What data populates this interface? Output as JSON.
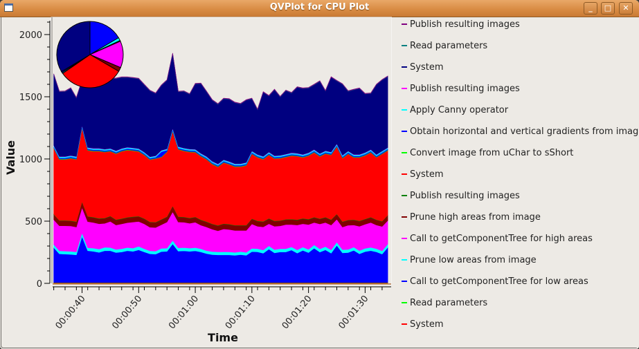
{
  "window": {
    "title": "QVPlot for CPU Plot",
    "buttons": {
      "minimize": "_",
      "maximize": "□",
      "close": "✕"
    }
  },
  "chart_data": {
    "type": "area",
    "stacked": true,
    "xlabel": "Time",
    "ylabel": "Value",
    "ylim": [
      0,
      2140
    ],
    "xlim_seconds": [
      34.8,
      94.6
    ],
    "yticks": [
      0,
      500,
      1000,
      1500,
      2000
    ],
    "xticks": [
      {
        "t": 40,
        "label": "00:00:40"
      },
      {
        "t": 50,
        "label": "00:00:50"
      },
      {
        "t": 60,
        "label": "00:01:00"
      },
      {
        "t": 70,
        "label": "00:01:10"
      },
      {
        "t": 80,
        "label": "00:01:20"
      },
      {
        "t": 90,
        "label": "00:01:30"
      }
    ],
    "legend_position": "right",
    "x": [
      35,
      36,
      37,
      38,
      39,
      40,
      41,
      42,
      43,
      44,
      45,
      46,
      47,
      48,
      49,
      50,
      51,
      52,
      53,
      54,
      55,
      56,
      57,
      58,
      59,
      60,
      61,
      62,
      63,
      64,
      65,
      66,
      67,
      68,
      69,
      70,
      71,
      72,
      73,
      74,
      75,
      76,
      77,
      78,
      79,
      80,
      81,
      82,
      83,
      84,
      85,
      86,
      87,
      88,
      89,
      90,
      91,
      92,
      93,
      94
    ],
    "series_stack_order_bottom_to_top": [
      {
        "name": "System",
        "color": "#e00000",
        "values": [
          5,
          5,
          5,
          5,
          5,
          5,
          5,
          5,
          5,
          5,
          5,
          5,
          5,
          5,
          5,
          5,
          5,
          5,
          5,
          5,
          5,
          5,
          5,
          5,
          5,
          5,
          5,
          5,
          5,
          5,
          5,
          5,
          5,
          5,
          5,
          5,
          5,
          5,
          5,
          5,
          5,
          5,
          5,
          5,
          5,
          5,
          5,
          5,
          5,
          5,
          5,
          5,
          5,
          5,
          5,
          5,
          5,
          5,
          5,
          5
        ]
      },
      {
        "name": "Read parameters",
        "color": "#00cc00",
        "values": [
          2,
          2,
          2,
          2,
          2,
          2,
          2,
          2,
          2,
          2,
          2,
          2,
          2,
          2,
          2,
          2,
          2,
          2,
          2,
          2,
          2,
          2,
          2,
          2,
          2,
          2,
          2,
          2,
          2,
          2,
          2,
          2,
          2,
          2,
          2,
          2,
          2,
          2,
          2,
          2,
          2,
          2,
          2,
          2,
          2,
          2,
          2,
          2,
          2,
          2,
          2,
          2,
          2,
          2,
          2,
          2,
          2,
          2,
          2,
          2
        ]
      },
      {
        "name": "Call to getComponentTree for low areas",
        "color": "#0000ff",
        "values": [
          280,
          230,
          228,
          226,
          222,
          370,
          255,
          250,
          242,
          255,
          255,
          240,
          245,
          255,
          250,
          262,
          245,
          230,
          228,
          248,
          250,
          310,
          252,
          254,
          250,
          254,
          245,
          232,
          224,
          222,
          222,
          222,
          218,
          224,
          218,
          248,
          246,
          235,
          268,
          238,
          245,
          245,
          260,
          236,
          258,
          240,
          276,
          244,
          262,
          236,
          298,
          238,
          240,
          258,
          230,
          248,
          256,
          246,
          228,
          282
        ]
      },
      {
        "name": "Prune low areas from image",
        "color": "#00ffff",
        "values": [
          26,
          24,
          24,
          24,
          24,
          28,
          24,
          26,
          26,
          28,
          26,
          26,
          26,
          26,
          26,
          28,
          26,
          24,
          24,
          26,
          26,
          28,
          26,
          26,
          26,
          26,
          26,
          24,
          24,
          24,
          24,
          24,
          24,
          24,
          24,
          26,
          26,
          26,
          26,
          26,
          26,
          26,
          26,
          26,
          26,
          26,
          26,
          26,
          26,
          26,
          26,
          26,
          26,
          26,
          26,
          26,
          26,
          26,
          26,
          26
        ]
      },
      {
        "name": "Call to getComponentTree for high areas",
        "color": "#ff00ff",
        "values": [
          200,
          202,
          204,
          204,
          200,
          204,
          210,
          206,
          204,
          192,
          210,
          196,
          200,
          200,
          210,
          200,
          200,
          190,
          190,
          190,
          210,
          230,
          208,
          204,
          200,
          204,
          190,
          190,
          180,
          170,
          184,
          180,
          176,
          170,
          176,
          196,
          180,
          186,
          178,
          188,
          184,
          194,
          180,
          200,
          188,
          200,
          180,
          200,
          194,
          200,
          184,
          182,
          194,
          178,
          196,
          194,
          200,
          190,
          196,
          190
        ]
      },
      {
        "name": "Prune high areas from image",
        "color": "#800000",
        "values": [
          40,
          40,
          40,
          40,
          40,
          44,
          40,
          40,
          40,
          40,
          40,
          40,
          40,
          40,
          40,
          40,
          40,
          40,
          40,
          40,
          40,
          44,
          40,
          40,
          40,
          40,
          40,
          40,
          40,
          40,
          40,
          40,
          40,
          40,
          40,
          40,
          40,
          40,
          40,
          40,
          40,
          40,
          40,
          40,
          40,
          40,
          40,
          40,
          40,
          40,
          40,
          40,
          40,
          40,
          40,
          40,
          40,
          40,
          40,
          40
        ]
      },
      {
        "name": "Publish resulting images",
        "color": "#008000",
        "values": [
          3,
          3,
          3,
          3,
          3,
          3,
          3,
          3,
          3,
          3,
          3,
          3,
          3,
          3,
          3,
          3,
          3,
          3,
          3,
          3,
          3,
          3,
          3,
          3,
          3,
          3,
          3,
          3,
          3,
          3,
          3,
          3,
          3,
          3,
          3,
          3,
          3,
          3,
          3,
          3,
          3,
          3,
          3,
          3,
          3,
          3,
          3,
          3,
          3,
          3,
          3,
          3,
          3,
          3,
          3,
          3,
          3,
          3,
          3,
          3
        ]
      },
      {
        "name": "System",
        "color": "#ff0000",
        "values": [
          530,
          490,
          490,
          500,
          500,
          590,
          530,
          530,
          540,
          530,
          520,
          530,
          540,
          540,
          530,
          520,
          510,
          500,
          510,
          500,
          520,
          600,
          540,
          530,
          530,
          520,
          510,
          500,
          480,
          470,
          490,
          480,
          470,
          470,
          480,
          520,
          510,
          500,
          510,
          500,
          500,
          500,
          510,
          510,
          490,
          510,
          520,
          500,
          510,
          520,
          540,
          510,
          530,
          500,
          510,
          510,
          520,
          500,
          540,
          520
        ]
      },
      {
        "name": "Convert image from uChar to sShort",
        "color": "#00ff00",
        "values": [
          4,
          4,
          4,
          4,
          4,
          4,
          4,
          4,
          4,
          4,
          4,
          4,
          4,
          4,
          4,
          4,
          4,
          4,
          4,
          4,
          4,
          4,
          4,
          4,
          4,
          4,
          4,
          4,
          4,
          4,
          4,
          4,
          4,
          4,
          4,
          4,
          4,
          4,
          4,
          4,
          4,
          4,
          4,
          4,
          4,
          4,
          4,
          4,
          4,
          4,
          4,
          4,
          4,
          4,
          4,
          4,
          4,
          4,
          4,
          4
        ]
      },
      {
        "name": "Obtain horizontal and vertical gradients from image",
        "color": "#0000ff",
        "values": [
          8,
          8,
          8,
          8,
          8,
          8,
          8,
          8,
          8,
          8,
          8,
          8,
          8,
          8,
          8,
          8,
          8,
          8,
          8,
          40,
          10,
          8,
          8,
          8,
          8,
          8,
          8,
          8,
          8,
          8,
          8,
          8,
          8,
          8,
          8,
          8,
          8,
          8,
          8,
          8,
          8,
          8,
          8,
          8,
          8,
          8,
          8,
          8,
          8,
          8,
          8,
          8,
          8,
          8,
          8,
          8,
          8,
          8,
          8,
          8
        ]
      },
      {
        "name": "Apply Canny operator",
        "color": "#00e0ff",
        "values": [
          10,
          10,
          10,
          10,
          10,
          10,
          10,
          10,
          10,
          10,
          10,
          10,
          10,
          10,
          10,
          10,
          10,
          10,
          10,
          10,
          10,
          10,
          10,
          10,
          10,
          10,
          10,
          10,
          10,
          10,
          10,
          10,
          10,
          10,
          10,
          10,
          10,
          10,
          10,
          10,
          10,
          10,
          10,
          10,
          10,
          10,
          10,
          10,
          10,
          10,
          10,
          10,
          10,
          10,
          10,
          10,
          10,
          10,
          10,
          10
        ]
      },
      {
        "name": "Publish resulting images",
        "color": "#ff00ff",
        "values": [
          2,
          2,
          2,
          2,
          2,
          2,
          2,
          2,
          2,
          2,
          2,
          2,
          2,
          2,
          2,
          2,
          2,
          2,
          2,
          2,
          2,
          2,
          2,
          2,
          2,
          2,
          2,
          2,
          2,
          2,
          2,
          2,
          2,
          2,
          2,
          2,
          2,
          2,
          2,
          2,
          2,
          2,
          2,
          2,
          2,
          2,
          2,
          2,
          2,
          2,
          2,
          2,
          2,
          2,
          2,
          2,
          2,
          2,
          2,
          2
        ]
      },
      {
        "name": "System",
        "color": "#000080",
        "values": [
          570,
          520,
          522,
          540,
          470,
          360,
          590,
          560,
          580,
          590,
          560,
          580,
          570,
          560,
          560,
          560,
          540,
          530,
          500,
          520,
          550,
          600,
          440,
          455,
          440,
          525,
          560,
          520,
          490,
          480,
          490,
          500,
          490,
          480,
          500,
          420,
          360,
          515,
          450,
          530,
          470,
          510,
          480,
          530,
          530,
          520,
          520,
          580,
          480,
          600,
          505,
          570,
          480,
          520,
          530,
          470,
          450,
          560,
          570,
          570
        ]
      },
      {
        "name": "Read parameters",
        "color": "#008080",
        "values": [
          2,
          2,
          2,
          2,
          2,
          2,
          2,
          2,
          2,
          2,
          2,
          2,
          2,
          2,
          2,
          2,
          2,
          2,
          2,
          2,
          2,
          2,
          2,
          2,
          2,
          2,
          2,
          2,
          2,
          2,
          2,
          2,
          2,
          2,
          2,
          2,
          2,
          2,
          2,
          2,
          2,
          2,
          2,
          2,
          2,
          2,
          2,
          2,
          2,
          2,
          2,
          2,
          2,
          2,
          2,
          2,
          2,
          2,
          2,
          2
        ]
      },
      {
        "name": "Publish resulting images",
        "color": "#800080",
        "values": [
          3,
          3,
          3,
          3,
          3,
          3,
          3,
          3,
          3,
          3,
          3,
          3,
          3,
          3,
          3,
          3,
          3,
          3,
          3,
          3,
          3,
          3,
          3,
          3,
          3,
          3,
          3,
          3,
          3,
          3,
          3,
          3,
          3,
          3,
          3,
          3,
          3,
          3,
          3,
          3,
          3,
          3,
          3,
          3,
          3,
          3,
          3,
          3,
          3,
          3,
          3,
          3,
          3,
          3,
          3,
          3,
          3,
          3,
          3,
          3
        ]
      }
    ],
    "pie": {
      "description": "inset pie of total share per series (clockwise from 12 o'clock)",
      "slices": [
        {
          "name": "Call to getComponentTree for low areas",
          "color": "#0000ff",
          "share": 0.165
        },
        {
          "name": "Prune low areas from image",
          "color": "#00ffff",
          "share": 0.015
        },
        {
          "name": "Read parameters",
          "color": "#00cc00",
          "share": 0.004
        },
        {
          "name": "Call to getComponentTree for high areas",
          "color": "#ff00ff",
          "share": 0.13
        },
        {
          "name": "Prune high areas from image",
          "color": "#800000",
          "share": 0.02
        },
        {
          "name": "System",
          "color": "#ff0000",
          "share": 0.32
        },
        {
          "name": "Apply Canny operator",
          "color": "#00e0ff",
          "share": 0.005
        },
        {
          "name": "Obtain horizontal and vertical gradients from image",
          "color": "#0000ff",
          "share": 0.005
        },
        {
          "name": "System",
          "color": "#000080",
          "share": 0.336
        }
      ]
    }
  },
  "legend": [
    {
      "label": "Publish resulting images",
      "color": "#800080"
    },
    {
      "label": "Read parameters",
      "color": "#008080"
    },
    {
      "label": "System",
      "color": "#000080"
    },
    {
      "label": "Publish resulting images",
      "color": "#ff00ff"
    },
    {
      "label": "Apply Canny operator",
      "color": "#00ffff"
    },
    {
      "label": "Obtain horizontal and vertical gradients from image",
      "color": "#0000ff"
    },
    {
      "label": "Convert image from uChar to sShort",
      "color": "#00ff00"
    },
    {
      "label": "System",
      "color": "#ff0000"
    },
    {
      "label": "Publish resulting images",
      "color": "#008000"
    },
    {
      "label": "Prune high areas from image",
      "color": "#800000"
    },
    {
      "label": "Call to getComponentTree for high areas",
      "color": "#ff00ff"
    },
    {
      "label": "Prune low areas from image",
      "color": "#00ffff"
    },
    {
      "label": "Call to getComponentTree for low areas",
      "color": "#0000ff"
    },
    {
      "label": "Read parameters",
      "color": "#00ff00"
    },
    {
      "label": "System",
      "color": "#ff0000"
    }
  ]
}
